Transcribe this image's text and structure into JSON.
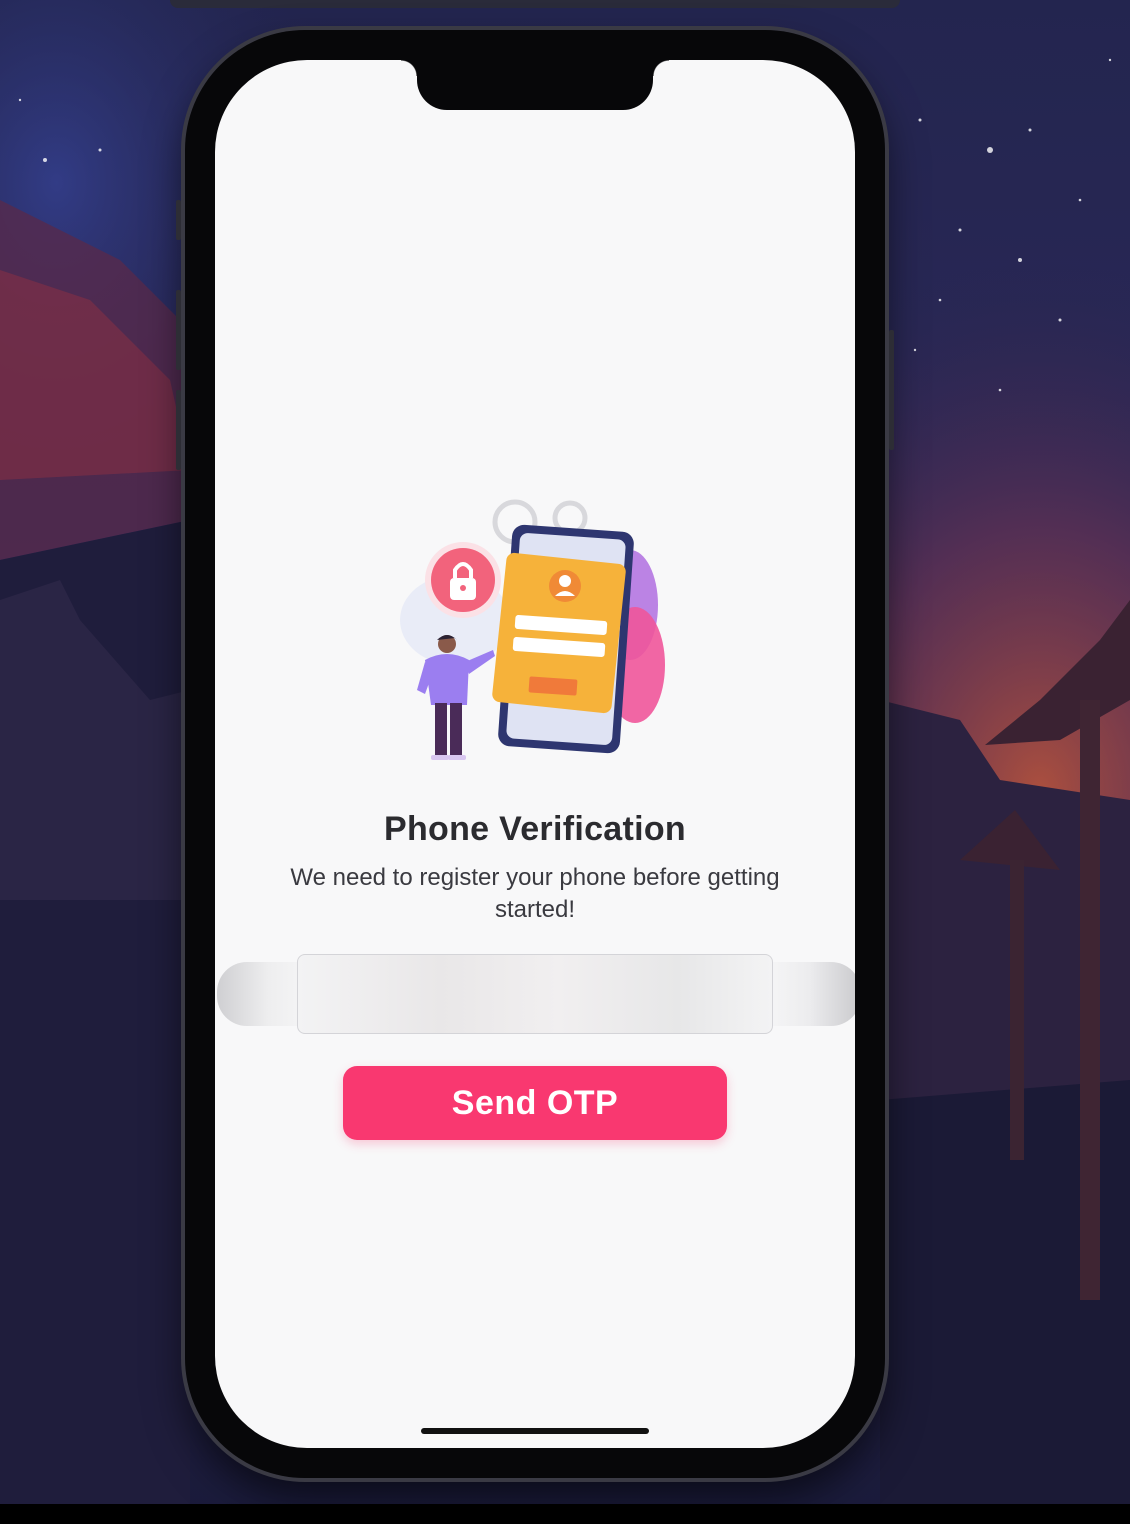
{
  "colors": {
    "accent": "#f93870",
    "screen_background": "#f8f8f9",
    "title_text": "#2b2b2f"
  },
  "illustration": {
    "icon": "phone-verification-illustration",
    "lock_icon": "lock-icon",
    "user_icon": "user-avatar-icon",
    "gear_icon": "gear-icon"
  },
  "verification": {
    "title": "Phone Verification",
    "subtitle": "We need to register your phone before getting started!",
    "phone_input_value": "",
    "send_button_label": "Send OTP"
  }
}
